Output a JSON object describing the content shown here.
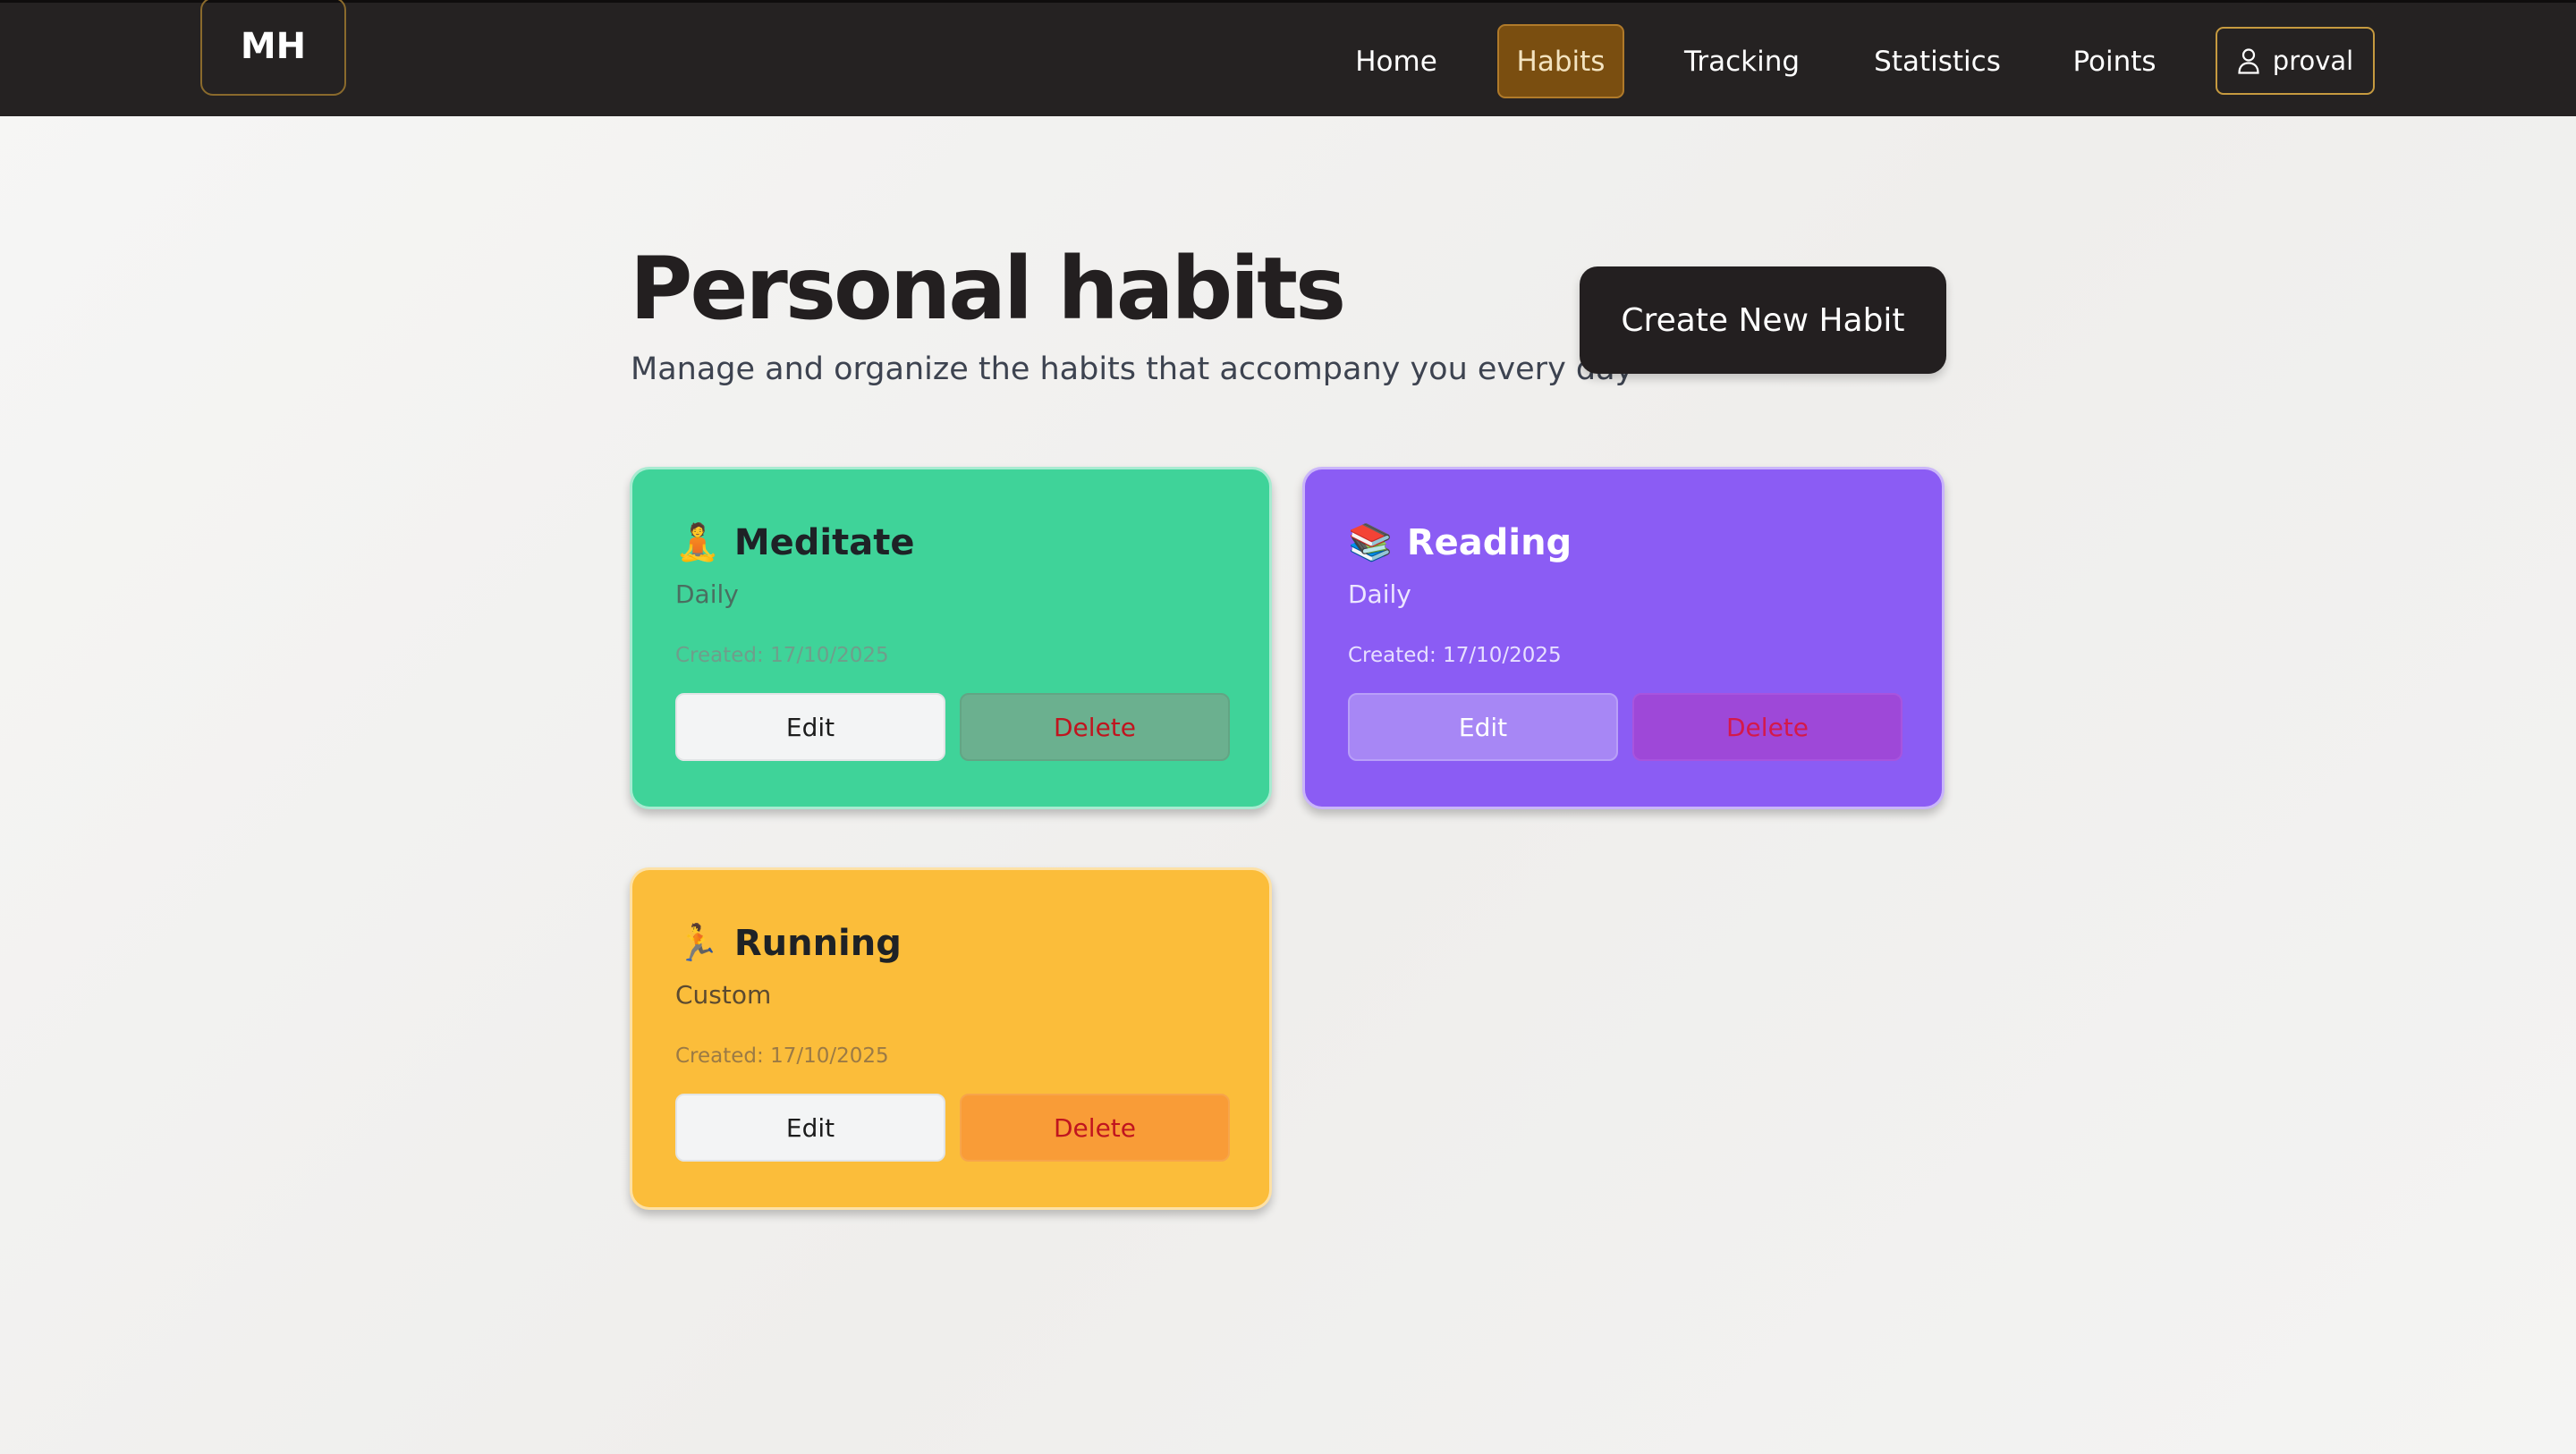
{
  "navbar": {
    "logo": "MH",
    "items": [
      {
        "label": "Home",
        "active": false
      },
      {
        "label": "Habits",
        "active": true
      },
      {
        "label": "Tracking",
        "active": false
      },
      {
        "label": "Statistics",
        "active": false
      },
      {
        "label": "Points",
        "active": false
      }
    ],
    "user": {
      "icon": "user-icon",
      "name": "proval"
    }
  },
  "header": {
    "title": "Personal habits",
    "subtitle": "Manage and organize the habits that accompany you every day",
    "create_button": "Create New Habit"
  },
  "habits": [
    {
      "emoji": "🧘",
      "name": "Meditate",
      "frequency": "Daily",
      "created": "Created: 17/10/2025",
      "edit_label": "Edit",
      "delete_label": "Delete",
      "color": "#3fd399"
    },
    {
      "emoji": "📚",
      "name": "Reading",
      "frequency": "Daily",
      "created": "Created: 17/10/2025",
      "edit_label": "Edit",
      "delete_label": "Delete",
      "color": "#8b5cf4"
    },
    {
      "emoji": "🏃",
      "name": "Running",
      "frequency": "Custom",
      "created": "Created: 17/10/2025",
      "edit_label": "Edit",
      "delete_label": "Delete",
      "color": "#fbbd3a"
    }
  ]
}
